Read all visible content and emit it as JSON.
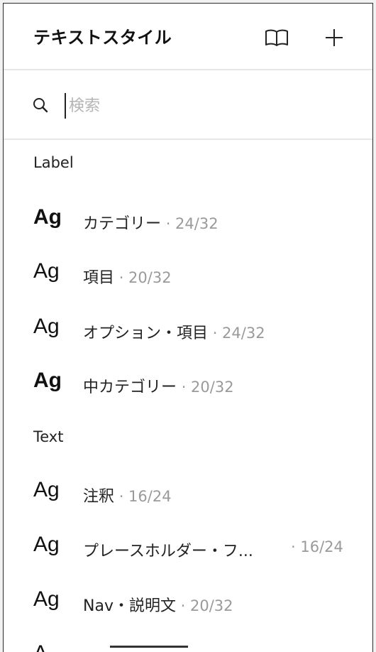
{
  "header": {
    "title": "テキストスタイル",
    "book_icon": "book-icon",
    "add_icon": "plus-icon"
  },
  "search": {
    "placeholder": "検索",
    "value": "",
    "icon": "search-icon"
  },
  "sections": [
    {
      "label": "Label",
      "items": [
        {
          "sample": "Ag",
          "name": "カテゴリー",
          "meta": " · 24/32",
          "bold": true
        },
        {
          "sample": "Ag",
          "name": "項目",
          "meta": " · 20/32",
          "bold": false
        },
        {
          "sample": "Ag",
          "name": "オプション・項目",
          "meta": " · 24/32",
          "bold": false
        },
        {
          "sample": "Ag",
          "name": "中カテゴリー",
          "meta": " · 20/32",
          "bold": true
        }
      ]
    },
    {
      "label": "Text",
      "items": [
        {
          "sample": "Ag",
          "name": "注釈",
          "meta": " · 16/24",
          "bold": false
        },
        {
          "sample": "Ag",
          "name": "プレースホルダー・フ...",
          "meta": " · 16/24",
          "bold": false
        },
        {
          "sample": "Ag",
          "name": "Nav・説明文",
          "meta": " · 20/32",
          "bold": false
        }
      ]
    }
  ]
}
